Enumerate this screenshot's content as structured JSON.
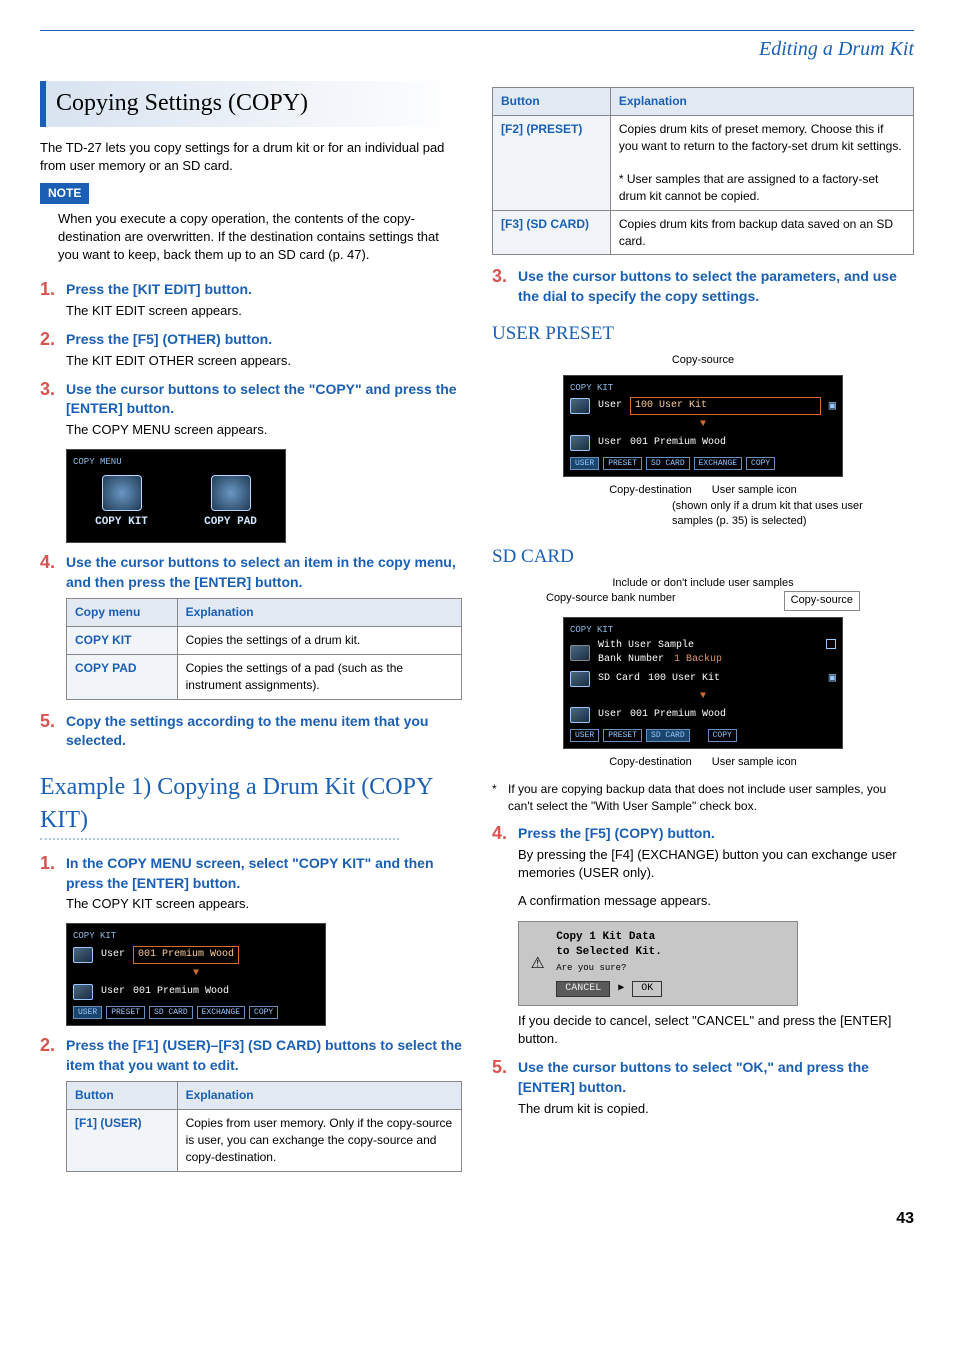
{
  "section_header": "Editing a Drum Kit",
  "title": "Copying Settings (COPY)",
  "intro_para": "The TD-27 lets you copy settings for a drum kit or for an individual pad from user memory or an SD card.",
  "note": {
    "badge": "NOTE",
    "body": "When you execute a copy operation, the contents of the copy-destination are overwritten. If the destination contains settings that you want to keep, back them up to an SD card (p. 47)."
  },
  "steps_a": [
    {
      "num": "1.",
      "head": "Press the [KIT EDIT] button.",
      "body": "The KIT EDIT screen appears."
    },
    {
      "num": "2.",
      "head": "Press the [F5] (OTHER) button.",
      "body": "The KIT EDIT OTHER screen appears."
    },
    {
      "num": "3.",
      "head": "Use the cursor buttons to select the \"COPY\" and press the [ENTER] button.",
      "body": "The COPY MENU screen appears."
    }
  ],
  "copy_menu_screen": {
    "title": "COPY MENU",
    "icons": [
      {
        "label": "COPY KIT"
      },
      {
        "label": "COPY PAD"
      }
    ]
  },
  "step_a4": {
    "num": "4.",
    "head": "Use the cursor buttons to select an item in the copy menu, and then press the [ENTER] button."
  },
  "copy_menu_table": {
    "headers": [
      "Copy menu",
      "Explanation"
    ],
    "rows": [
      [
        "COPY KIT",
        "Copies the settings of a drum kit."
      ],
      [
        "COPY PAD",
        "Copies the settings of a pad (such as the instrument assignments)."
      ]
    ]
  },
  "step_a5": {
    "num": "5.",
    "head": "Copy the settings according to the menu item that you selected."
  },
  "example_title": "Example 1) Copying a Drum Kit (COPY KIT)",
  "steps_b": [
    {
      "num": "1.",
      "head": "In the COPY MENU screen, select \"COPY KIT\" and then press the [ENTER] button.",
      "body": "The COPY KIT screen appears."
    }
  ],
  "copy_kit_screen": {
    "title": "COPY KIT",
    "rows": [
      {
        "label": "User",
        "kit": "001 Premium Wood"
      },
      {
        "label": "User",
        "kit": "001 Premium Wood"
      }
    ],
    "tabs": [
      "USER",
      "PRESET",
      "SD CARD",
      "EXCHANGE",
      "COPY"
    ]
  },
  "step_b2": {
    "num": "2.",
    "head": "Press the [F1] (USER)–[F3] (SD CARD) buttons to select the item that you want to edit."
  },
  "button_table": {
    "headers": [
      "Button",
      "Explanation"
    ],
    "rows": [
      [
        "[F1] (USER)",
        "Copies from user memory. Only if the copy-source is user, you can exchange the copy-source and copy-destination."
      ],
      [
        "[F2] (PRESET)",
        "Copies drum kits of preset memory. Choose this if you want to return to the factory-set drum kit settings.\n\n*  User samples that are assigned to a factory-set drum kit cannot be copied."
      ],
      [
        "[F3] (SD CARD)",
        "Copies drum kits from backup data saved on an SD card."
      ]
    ]
  },
  "step_b3": {
    "num": "3.",
    "head": "Use the cursor buttons to select the parameters, and use the dial to specify the copy settings."
  },
  "user_preset": {
    "title": "USER PRESET",
    "caption_top": "Copy-source",
    "screen_title": "COPY KIT",
    "rows": [
      {
        "label": "User",
        "kit": "100 User Kit"
      },
      {
        "label": "User",
        "kit": "001 Premium Wood"
      }
    ],
    "tabs": [
      "USER",
      "PRESET",
      "SD CARD",
      "EXCHANGE",
      "COPY"
    ],
    "caption_bottom_left": "Copy-destination",
    "caption_bottom_right": "User sample icon",
    "note": "(shown only if a drum kit that uses user samples (p. 35) is selected)"
  },
  "sd_card": {
    "title": "SD CARD",
    "caption_top": "Include or don't include user samples",
    "caption_lines": [
      "Copy-source bank number",
      "Copy-source"
    ],
    "screen_title": "COPY KIT",
    "opt_label": "With User Sample",
    "bank_label": "Bank Number",
    "bank_val": "1 Backup",
    "rows": [
      {
        "label": "SD Card",
        "kit": "100 User Kit"
      },
      {
        "label": "User",
        "kit": "001 Premium Wood"
      }
    ],
    "tabs": [
      "USER",
      "PRESET",
      "SD CARD",
      "",
      "COPY"
    ],
    "caption_bottom_left": "Copy-destination",
    "caption_bottom_right": "User sample icon"
  },
  "sd_footnote": "If you are copying backup data that does not include user samples, you can't select the \"With User Sample\" check box.",
  "step_b4": {
    "num": "4.",
    "head": "Press the [F5] (COPY) button.",
    "body": "By pressing the [F4] (EXCHANGE) button you can exchange user memories (USER only).",
    "body2": "A confirmation message appears."
  },
  "confirm_dialog": {
    "line1": "Copy 1 Kit Data",
    "line2": "to Selected Kit.",
    "prompt": "Are you sure?",
    "cancel": "CANCEL",
    "ok": "OK"
  },
  "after_confirm": "If you decide to cancel, select \"CANCEL\" and press the [ENTER] button.",
  "step_b5": {
    "num": "5.",
    "head": "Use the cursor buttons to select \"OK,\" and press the [ENTER] button.",
    "body": "The drum kit is copied."
  },
  "page_number": "43"
}
